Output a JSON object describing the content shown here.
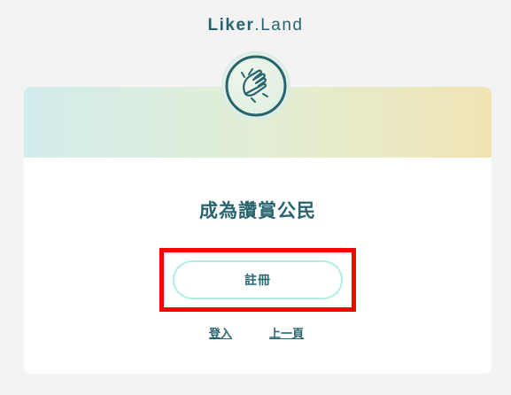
{
  "logo": {
    "part1": "Liker",
    "sep": ".",
    "part2": "Land"
  },
  "card": {
    "avatar_icon": "clapping-hands-icon",
    "title": "成為讚賞公民",
    "register_label": "註冊",
    "login_label": "登入",
    "back_label": "上一頁"
  },
  "colors": {
    "brand": "#28646e",
    "button_border": "#aeeee4",
    "header_gradient_start": "#d2ecec",
    "header_gradient_end": "#f0e4b4",
    "highlight": "#ff0000"
  }
}
